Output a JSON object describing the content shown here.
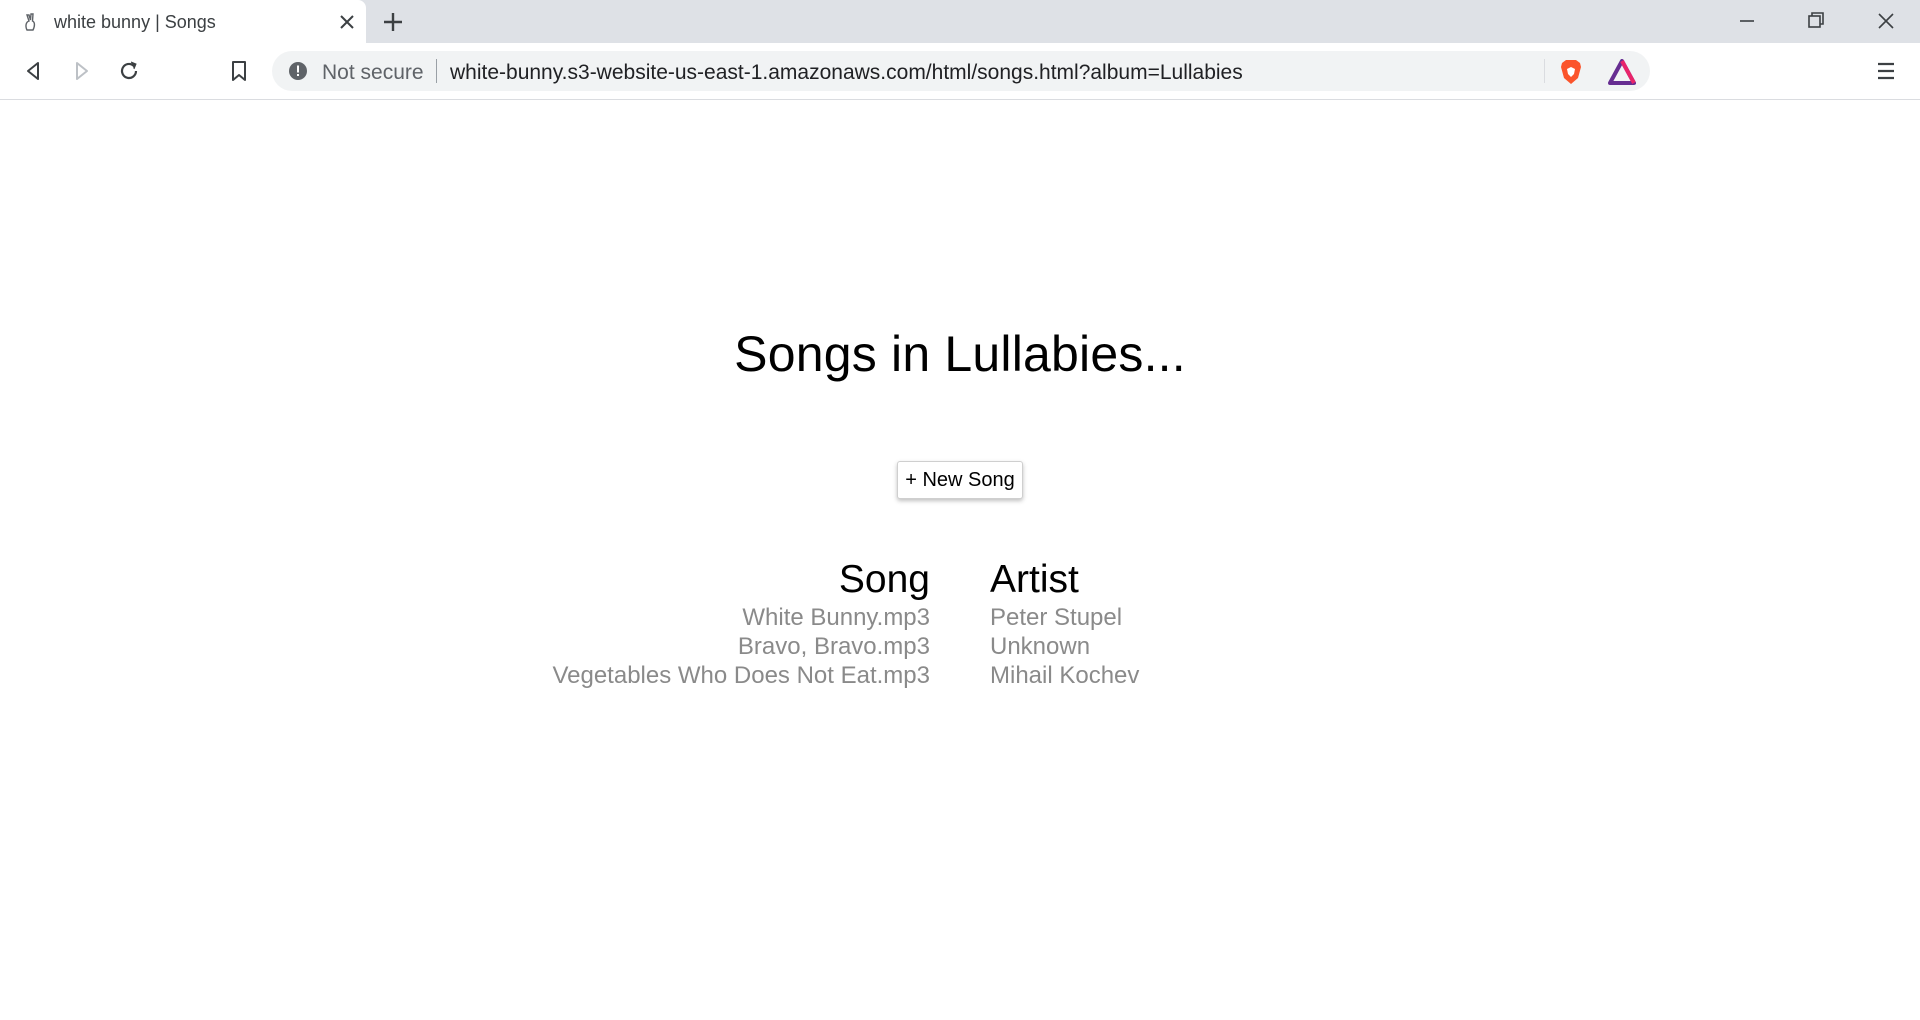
{
  "browser": {
    "tab": {
      "title": "white bunny | Songs"
    },
    "omnibox": {
      "security_label": "Not secure",
      "url": "white-bunny.s3-website-us-east-1.amazonaws.com/html/songs.html?album=Lullabies"
    }
  },
  "page": {
    "title": "Songs in Lullabies...",
    "new_song_label": "+ New Song",
    "table": {
      "headers": {
        "song": "Song",
        "artist": "Artist"
      },
      "rows": [
        {
          "song": "White Bunny.mp3",
          "artist": "Peter Stupel"
        },
        {
          "song": "Bravo, Bravo.mp3",
          "artist": "Unknown"
        },
        {
          "song": "Vegetables Who Does Not Eat.mp3",
          "artist": "Mihail Kochev"
        }
      ]
    }
  },
  "colors": {
    "tabstrip": "#dee1e6",
    "omnibox": "#f1f3f4",
    "brave_orange": "#fb542b",
    "rewards_purple": "#662d91"
  },
  "icons": [
    "bunny-favicon-icon",
    "close-icon",
    "plus-icon",
    "minimize-icon",
    "restore-icon",
    "window-close-icon",
    "back-icon",
    "forward-icon",
    "reload-icon",
    "bookmark-icon",
    "info-icon",
    "brave-shield-icon",
    "brave-rewards-icon",
    "menu-icon"
  ]
}
